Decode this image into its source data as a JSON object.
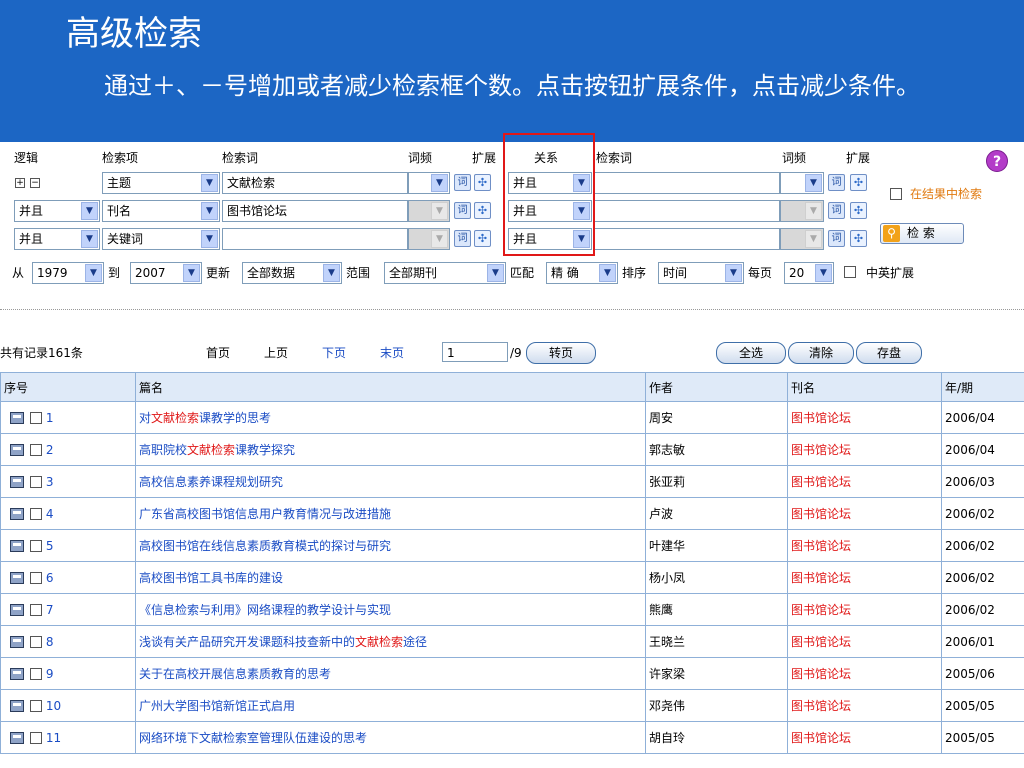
{
  "slide": {
    "title": "高级检索",
    "subtitle": "通过＋、－号增加或者减少检索框个数。点击按钮扩展条件，点击减少条件。"
  },
  "form": {
    "headers": {
      "logic": "逻辑",
      "field": "检索项",
      "term": "检索词",
      "freq": "词频",
      "expand": "扩展",
      "relation": "关系",
      "term2": "检索词",
      "freq2": "词频",
      "expand2": "扩展"
    },
    "rows": [
      {
        "logic": "",
        "field": "主题",
        "term": "文献检索",
        "relation": "并且",
        "term2": ""
      },
      {
        "logic": "并且",
        "field": "刊名",
        "term": "图书馆论坛",
        "relation": "并且",
        "term2": ""
      },
      {
        "logic": "并且",
        "field": "关键词",
        "term": "",
        "relation": "并且",
        "term2": ""
      }
    ],
    "in_results_label": "在结果中检索",
    "search_button": "检 索",
    "filters": {
      "from_label": "从",
      "from_value": "1979",
      "to_label": "到",
      "to_value": "2007",
      "update_label": "更新",
      "update_value": "全部数据",
      "range_label": "范围",
      "range_value": "全部期刊",
      "match_label": "匹配",
      "match_value": "精 确",
      "sort_label": "排序",
      "sort_value": "时间",
      "per_page_label": "每页",
      "per_page_value": "20",
      "cn_en_label": "中英扩展"
    }
  },
  "pager": {
    "total": "共有记录161条",
    "first": "首页",
    "prev": "上页",
    "next": "下页",
    "last": "末页",
    "page_value": "1",
    "page_total": "/9",
    "goto": "转页",
    "select_all": "全选",
    "clear": "清除",
    "save": "存盘"
  },
  "table": {
    "columns": [
      "序号",
      "篇名",
      "作者",
      "刊名",
      "年/期"
    ],
    "rows": [
      {
        "num": "1",
        "title_pre": "对",
        "title_hl": "文献检索",
        "title_post": "课教学的思考",
        "author": "周安",
        "journal": "图书馆论坛",
        "issue": "2006/04"
      },
      {
        "num": "2",
        "title_pre": "高职院校",
        "title_hl": "文献检索",
        "title_post": "课教学探究",
        "author": "郭志敏",
        "journal": "图书馆论坛",
        "issue": "2006/04"
      },
      {
        "num": "3",
        "title_pre": "高校信息素养课程规划研究",
        "title_hl": "",
        "title_post": "",
        "author": "张亚莉",
        "journal": "图书馆论坛",
        "issue": "2006/03"
      },
      {
        "num": "4",
        "title_pre": "广东省高校图书馆信息用户教育情况与改进措施",
        "title_hl": "",
        "title_post": "",
        "author": "卢波",
        "journal": "图书馆论坛",
        "issue": "2006/02"
      },
      {
        "num": "5",
        "title_pre": "高校图书馆在线信息素质教育模式的探讨与研究",
        "title_hl": "",
        "title_post": "",
        "author": "叶建华",
        "journal": "图书馆论坛",
        "issue": "2006/02"
      },
      {
        "num": "6",
        "title_pre": "高校图书馆工具书库的建设",
        "title_hl": "",
        "title_post": "",
        "author": "杨小凤",
        "journal": "图书馆论坛",
        "issue": "2006/02"
      },
      {
        "num": "7",
        "title_pre": "《信息检索与利用》网络课程的教学设计与实现",
        "title_hl": "",
        "title_post": "",
        "author": "熊鹰",
        "journal": "图书馆论坛",
        "issue": "2006/02"
      },
      {
        "num": "8",
        "title_pre": "浅谈有关产品研究开发课题科技查新中的",
        "title_hl": "文献检索",
        "title_post": "途径",
        "author": "王晓兰",
        "journal": "图书馆论坛",
        "issue": "2006/01"
      },
      {
        "num": "9",
        "title_pre": "关于在高校开展信息素质教育的思考",
        "title_hl": "",
        "title_post": "",
        "author": "许家梁",
        "journal": "图书馆论坛",
        "issue": "2005/06"
      },
      {
        "num": "10",
        "title_pre": "广州大学图书馆新馆正式启用",
        "title_hl": "",
        "title_post": "",
        "author": "邓尧伟",
        "journal": "图书馆论坛",
        "issue": "2005/05"
      },
      {
        "num": "11",
        "title_pre": "网络环境下文献检索室管理队伍建设的思考",
        "title_hl": "",
        "title_post": "",
        "author": "胡自玲",
        "journal": "图书馆论坛",
        "issue": "2005/05"
      }
    ]
  },
  "colors": {
    "header_bg": "#1c66c4",
    "link": "#1a4cc4",
    "highlight": "#e01818"
  }
}
